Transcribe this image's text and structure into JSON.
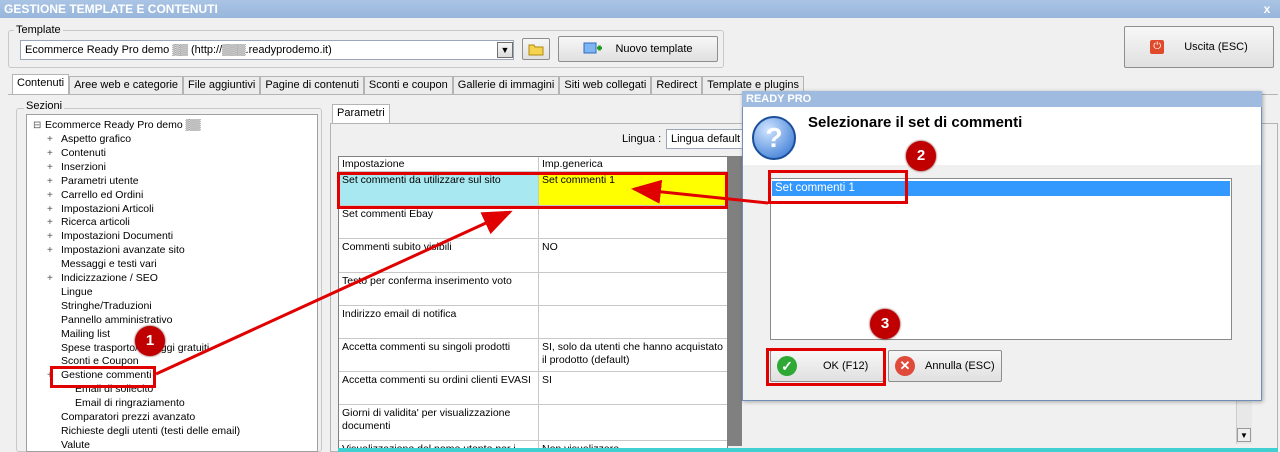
{
  "window": {
    "title": "GESTIONE TEMPLATE E CONTENUTI",
    "close_glyph": "x"
  },
  "template_group": {
    "label": "Template",
    "combo_value": "Ecommerce Ready Pro demo ▒▒ (http://▒▒▒.readyprodemo.it)",
    "new_template_label": "Nuovo template"
  },
  "exit_button": {
    "label": "Uscita (ESC)"
  },
  "tabs": [
    {
      "label": "Contenuti"
    },
    {
      "label": "Aree web e categorie"
    },
    {
      "label": "File aggiuntivi"
    },
    {
      "label": "Pagine di contenuti"
    },
    {
      "label": "Sconti e coupon"
    },
    {
      "label": "Gallerie di immagini"
    },
    {
      "label": "Siti web collegati"
    },
    {
      "label": "Redirect"
    },
    {
      "label": "Template e plugins"
    }
  ],
  "sections": {
    "label": "Sezioni",
    "root": "Ecommerce Ready Pro demo ▒▒",
    "items": [
      {
        "label": "Aspetto grafico",
        "expand": true
      },
      {
        "label": "Contenuti",
        "expand": true
      },
      {
        "label": "Inserzioni",
        "expand": true
      },
      {
        "label": "Parametri utente",
        "expand": true
      },
      {
        "label": "Carrello ed Ordini",
        "expand": true
      },
      {
        "label": "Impostazioni Articoli",
        "expand": true
      },
      {
        "label": "Ricerca articoli",
        "expand": true
      },
      {
        "label": "Impostazioni Documenti",
        "expand": true
      },
      {
        "label": "Impostazioni avanzate sito",
        "expand": true
      },
      {
        "label": "Messaggi e testi vari",
        "expand": false
      },
      {
        "label": "Indicizzazione / SEO",
        "expand": true
      },
      {
        "label": "Lingue",
        "expand": false
      },
      {
        "label": "Stringhe/Traduzioni",
        "expand": false
      },
      {
        "label": "Pannello amministrativo",
        "expand": false
      },
      {
        "label": "Mailing list",
        "expand": false
      },
      {
        "label": "Spese trasporto/Omaggi gratuiti",
        "expand": false
      },
      {
        "label": "Sconti e Coupon",
        "expand": false
      },
      {
        "label": "Gestione commenti",
        "expand": true
      },
      {
        "label": "Email di sollecito",
        "expand": false,
        "child": true
      },
      {
        "label": "Email di ringraziamento",
        "expand": false,
        "child": true
      },
      {
        "label": "Comparatori prezzi avanzato",
        "expand": false
      },
      {
        "label": "Richieste degli utenti (testi delle email)",
        "expand": false
      },
      {
        "label": "Valute",
        "expand": false
      }
    ]
  },
  "parameters": {
    "tab_label": "Parametri",
    "language_label": "Lingua :",
    "language_value": "Lingua default",
    "header": [
      "Impostazione",
      "Imp.generica"
    ],
    "rows": [
      {
        "setting": "Set commenti da utilizzare sul sito",
        "value": "Set commenti 1"
      },
      {
        "setting": "Set commenti Ebay",
        "value": ""
      },
      {
        "setting": "Commenti subito visibili",
        "value": "NO"
      },
      {
        "setting": "Testo per conferma inserimento voto",
        "value": ""
      },
      {
        "setting": "Indirizzo email di notifica",
        "value": ""
      },
      {
        "setting": "Accetta commenti su singoli prodotti",
        "value": "SI, solo da utenti che hanno acquistato il prodotto (default)"
      },
      {
        "setting": "Accetta commenti su ordini clienti EVASI",
        "value": "SI"
      },
      {
        "setting": "Giorni di validita' per visualizzazione documenti",
        "value": ""
      },
      {
        "setting": "Visualizzazione del nome utente per i",
        "value": "Non visualizzare"
      }
    ]
  },
  "dialog": {
    "title": "READY PRO",
    "heading": "Selezionare il set di commenti",
    "list_items": [
      "Set commenti 1"
    ],
    "ok_label": "OK (F12)",
    "cancel_label": "Annulla (ESC)"
  },
  "badges": [
    "1",
    "2",
    "3"
  ],
  "colors": {
    "highlight_row": "#a8e8f0",
    "selected_value": "#ffff00",
    "annotation_red": "#e00000",
    "list_selection": "#3399ff"
  }
}
